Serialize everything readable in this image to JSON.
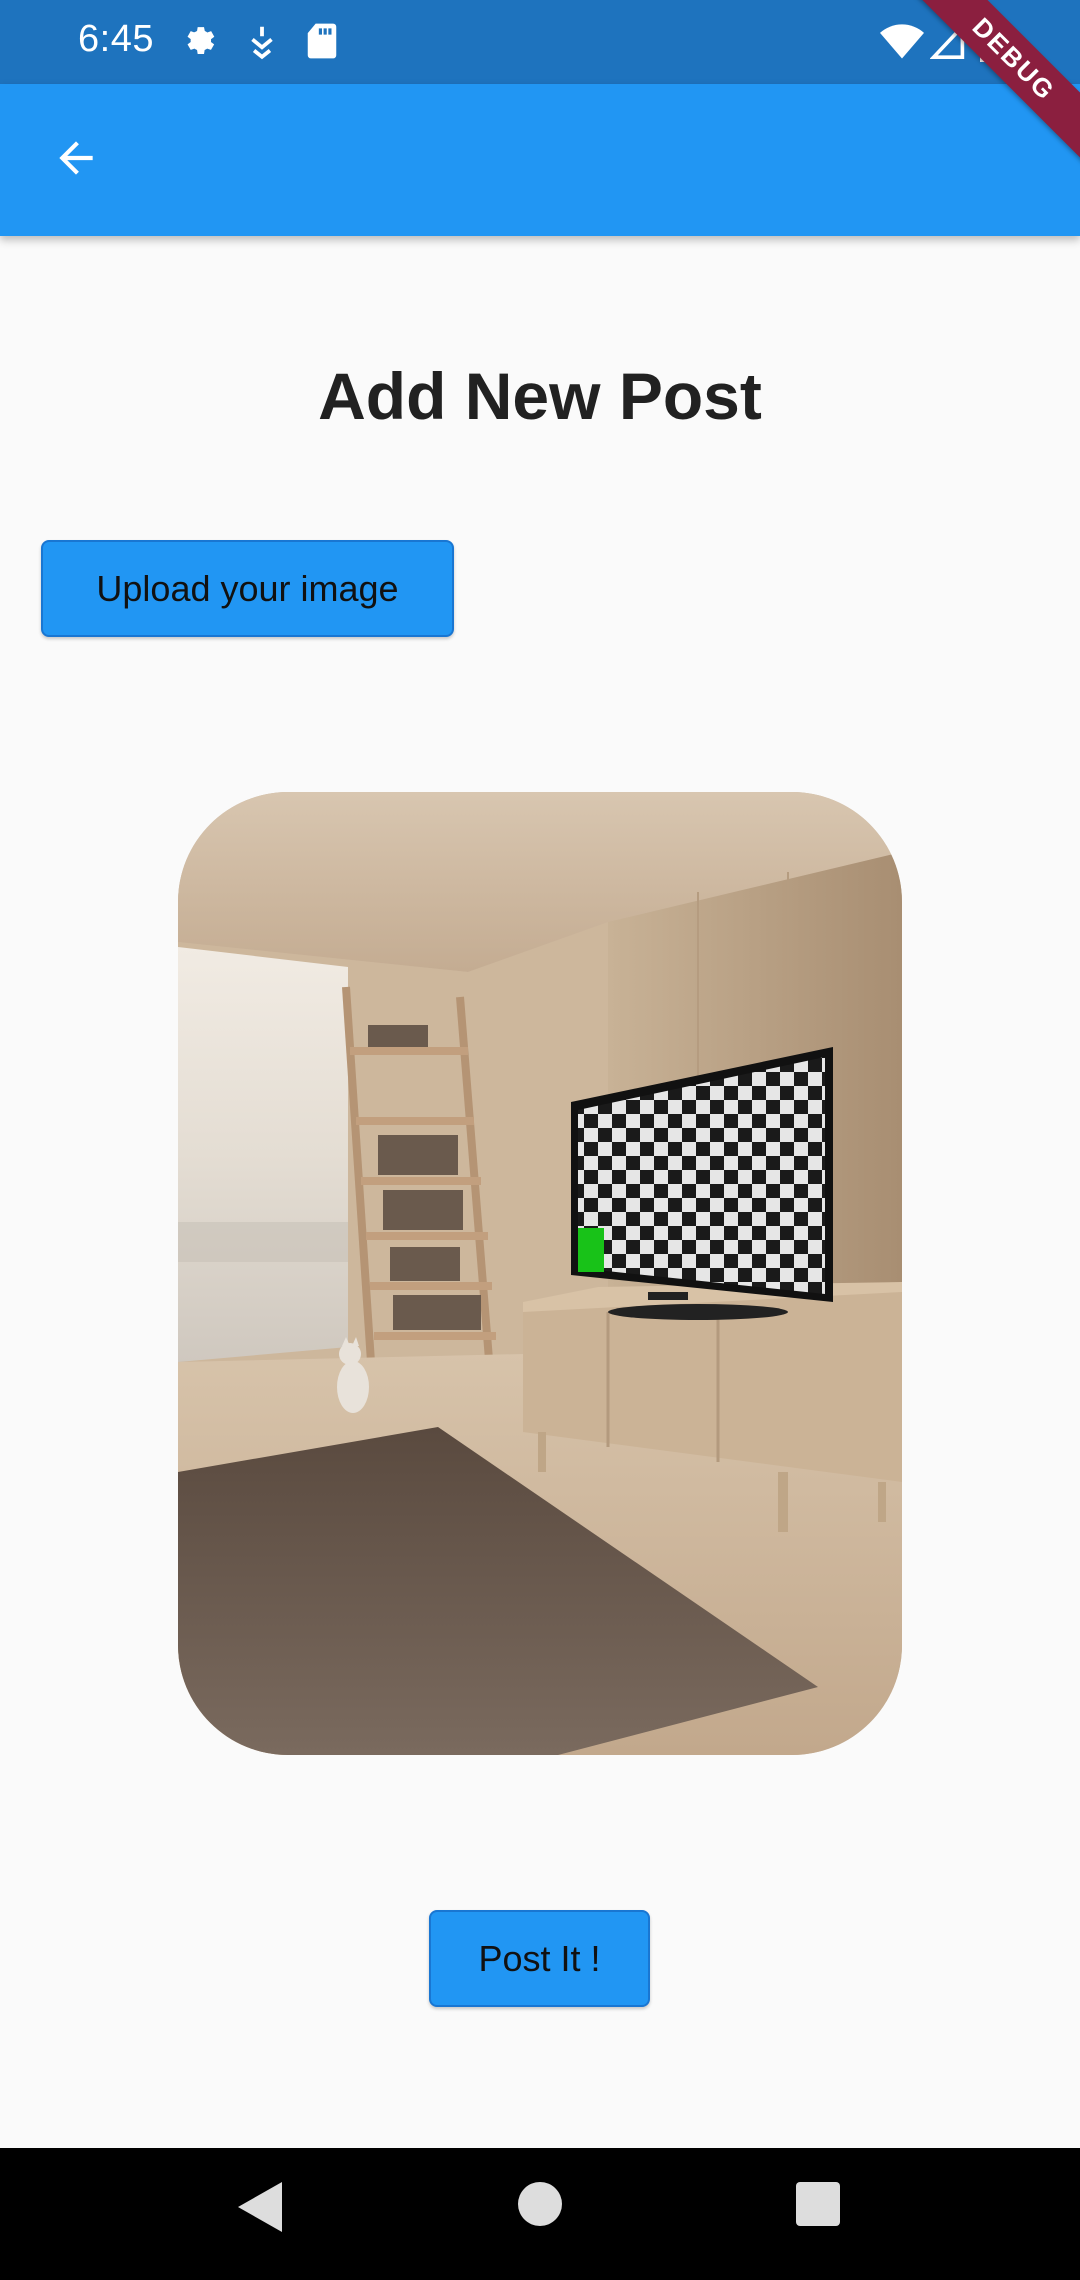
{
  "status_bar": {
    "time": "6:45",
    "left_icons": [
      "gear-icon",
      "usb-debug-icon",
      "sd-card-icon"
    ],
    "right_icons": [
      "wifi-icon",
      "cell-signal-icon",
      "battery-icon"
    ],
    "debug_banner": "DEBUG"
  },
  "app_bar": {
    "back_icon": "arrow-back-icon"
  },
  "page": {
    "title": "Add New Post",
    "upload_label": "Upload your image",
    "post_label": "Post It !"
  },
  "image_preview": {
    "subject": "living room with bookshelf ladder, tv with checkerboard screen, cat and rug"
  },
  "nav_bar": {
    "buttons": [
      "back-triangle-icon",
      "home-circle-icon",
      "recents-square-icon"
    ]
  },
  "colors": {
    "status_bar": "#1e73be",
    "app_bar": "#2196f3",
    "button": "#2196f3",
    "background": "#fafafa",
    "debug_ribbon": "#8b1f3f"
  }
}
